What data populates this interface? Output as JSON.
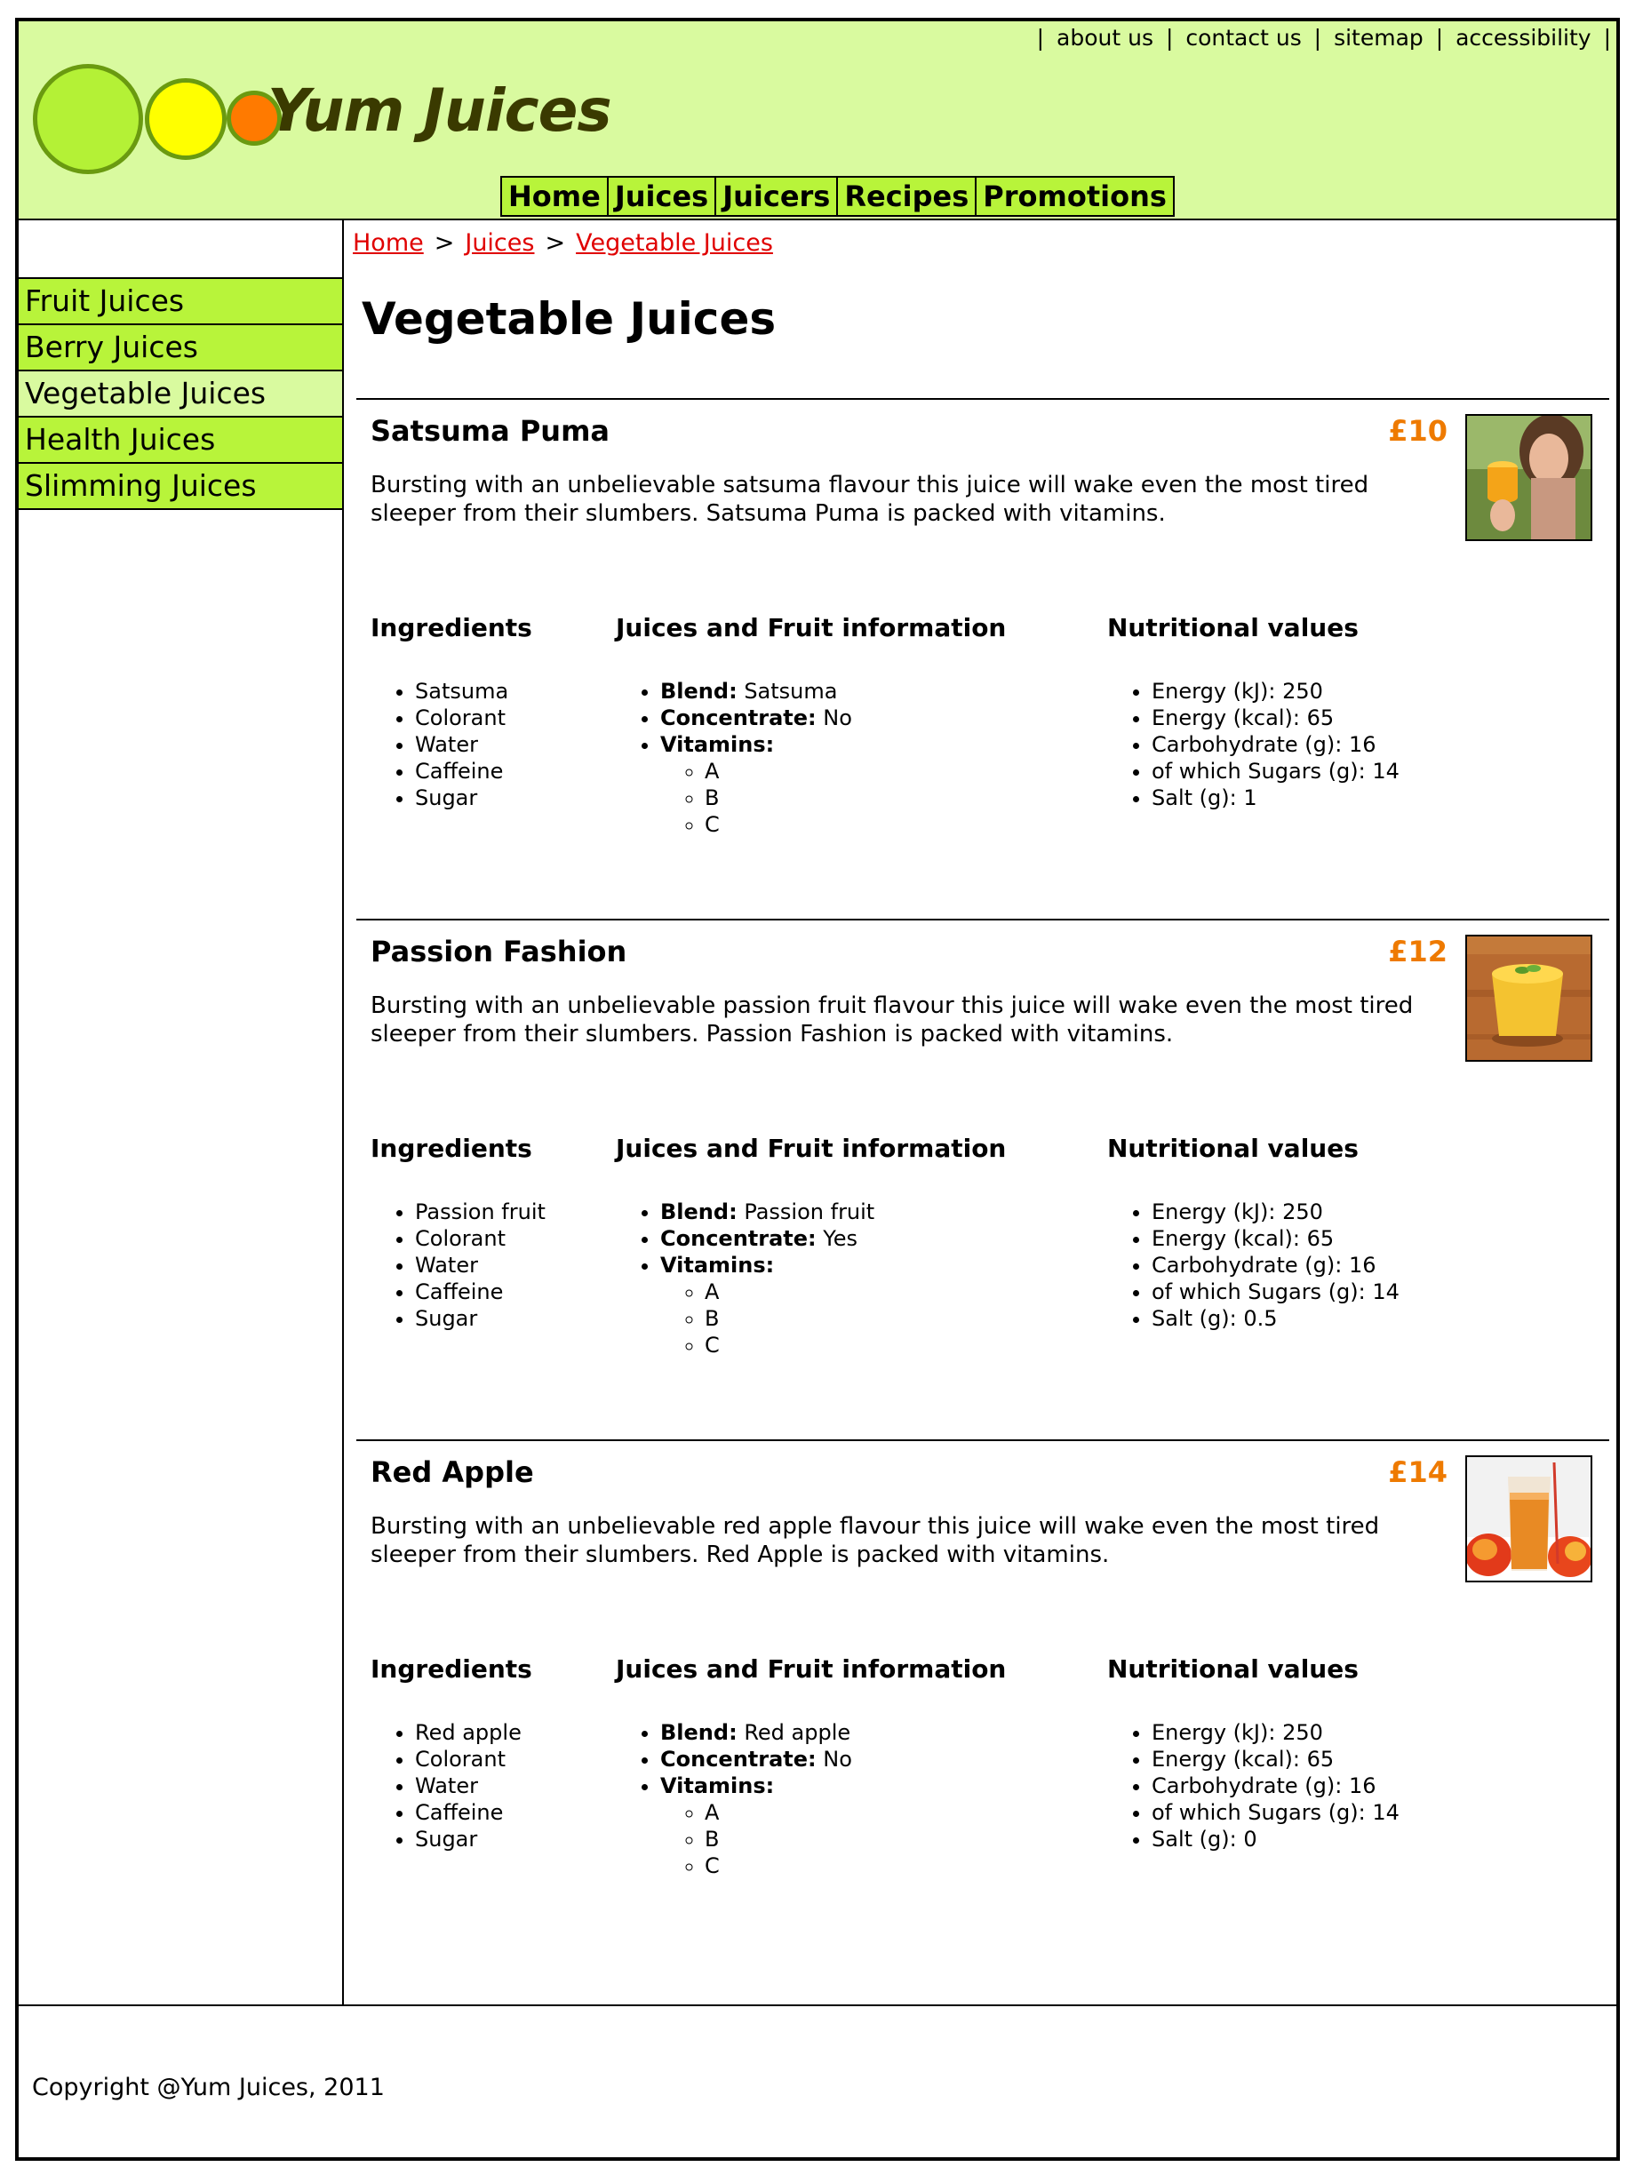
{
  "header": {
    "brand": "Yum Juices",
    "utility_links": [
      "about us",
      "contact us",
      "sitemap",
      "accessibility"
    ],
    "nav": [
      "Home",
      "Juices",
      "Juicers",
      "Recipes",
      "Promotions"
    ],
    "colors": {
      "header_bg": "#d9fa9f",
      "nav_bg": "#b8f43a",
      "circle_green": "#b4f136",
      "circle_yellow": "#ffff00",
      "circle_orange": "#ff7a00"
    }
  },
  "sidebar": {
    "items": [
      {
        "label": "Fruit Juices",
        "active": false
      },
      {
        "label": "Berry Juices",
        "active": false
      },
      {
        "label": "Vegetable Juices",
        "active": true
      },
      {
        "label": "Health Juices",
        "active": false
      },
      {
        "label": "Slimming Juices",
        "active": false
      }
    ]
  },
  "breadcrumb": [
    "Home",
    "Juices",
    "Vegetable Juices"
  ],
  "page_title": "Vegetable Juices",
  "labels": {
    "ingredients": "Ingredients",
    "info": "Juices and Fruit information",
    "nutrition": "Nutritional values",
    "blend": "Blend:",
    "concentrate": "Concentrate:",
    "vitamins": "Vitamins:"
  },
  "products": [
    {
      "name": "Satsuma Puma",
      "price": "£10",
      "description": "Bursting with an unbelievable satsuma flavour this juice will wake even the most tired sleeper from their slumbers. Satsuma Puma is packed with vitamins.",
      "image": "woman-holding-orange-juice-photo",
      "ingredients": [
        "Satsuma",
        "Colorant",
        "Water",
        "Caffeine",
        "Sugar"
      ],
      "blend": "Satsuma",
      "concentrate": "No",
      "vitamins": [
        "A",
        "B",
        "C"
      ],
      "nutrition": [
        "Energy (kJ): 250",
        "Energy (kcal): 65",
        "Carbohydrate (g): 16",
        "of which Sugars (g): 14",
        "Salt (g): 1"
      ]
    },
    {
      "name": "Passion Fashion",
      "price": "£12",
      "description": "Bursting with an unbelievable passion fruit flavour this juice will wake even the most tired sleeper from their slumbers. Passion Fashion is packed with vitamins.",
      "image": "passion-fruit-smoothie-photo",
      "ingredients": [
        "Passion fruit",
        "Colorant",
        "Water",
        "Caffeine",
        "Sugar"
      ],
      "blend": "Passion fruit",
      "concentrate": "Yes",
      "vitamins": [
        "A",
        "B",
        "C"
      ],
      "nutrition": [
        "Energy (kJ): 250",
        "Energy (kcal): 65",
        "Carbohydrate (g): 16",
        "of which Sugars (g): 14",
        "Salt (g): 0.5"
      ]
    },
    {
      "name": "Red Apple",
      "price": "£14",
      "description": "Bursting with an unbelievable red apple flavour this juice will wake even the most tired sleeper from their slumbers. Red Apple is packed with vitamins.",
      "image": "apple-juice-glass-photo",
      "ingredients": [
        "Red apple",
        "Colorant",
        "Water",
        "Caffeine",
        "Sugar"
      ],
      "blend": "Red apple",
      "concentrate": "No",
      "vitamins": [
        "A",
        "B",
        "C"
      ],
      "nutrition": [
        "Energy (kJ): 250",
        "Energy (kcal): 65",
        "Carbohydrate (g): 16",
        "of which Sugars (g): 14",
        "Salt (g): 0"
      ]
    }
  ],
  "footer": {
    "copyright": "Copyright @Yum Juices, 2011"
  }
}
